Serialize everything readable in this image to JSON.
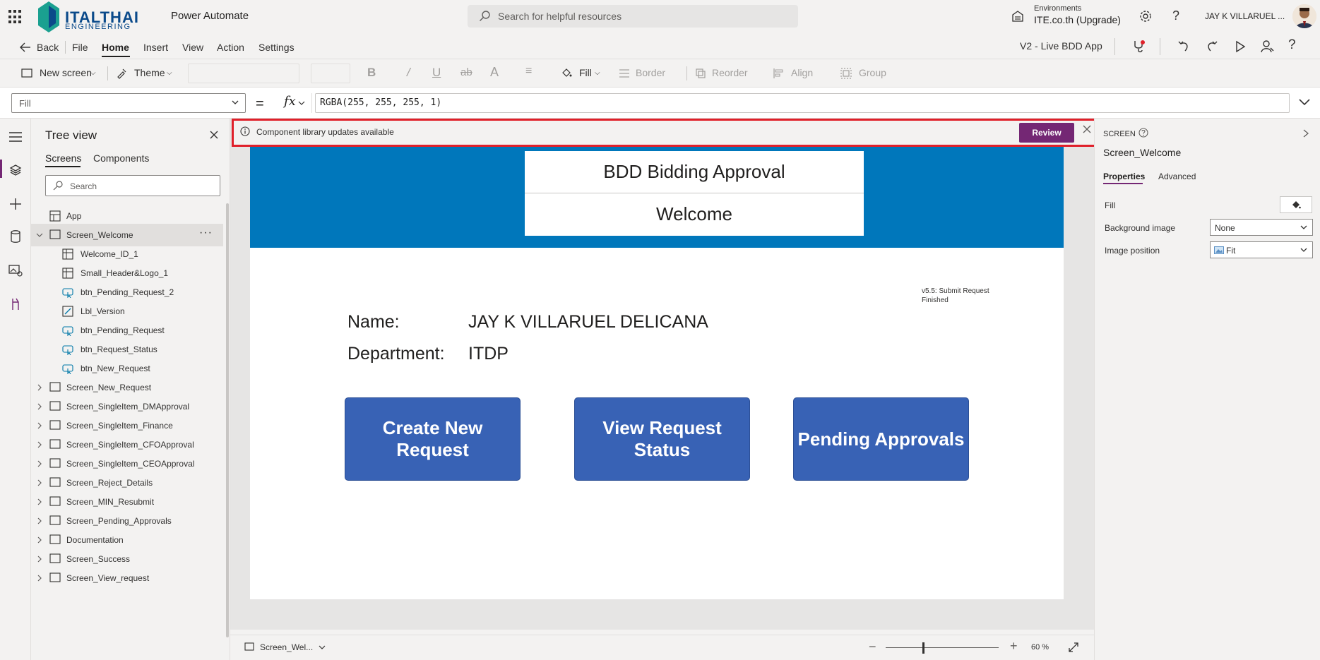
{
  "topbar": {
    "logo_primary": "ITALTHAI",
    "logo_secondary": "ENGINEERING",
    "app_name": "Power Automate",
    "search_placeholder": "Search for helpful resources",
    "environment_label": "Environments",
    "environment_name": "ITE.co.th (Upgrade)",
    "help_glyph": "?",
    "user_name": "JAY K VILLARUEL ..."
  },
  "menubar": {
    "back_label": "Back",
    "items": [
      "File",
      "Home",
      "Insert",
      "View",
      "Action",
      "Settings"
    ],
    "active": "Home",
    "app_version_name": "V2 - Live BDD App"
  },
  "ribbon": {
    "new_screen": "New screen",
    "theme": "Theme",
    "fill": "Fill",
    "border": "Border",
    "reorder": "Reorder",
    "align": "Align",
    "group": "Group"
  },
  "formula": {
    "property": "Fill",
    "equals": "=",
    "fx": "fx",
    "value": "RGBA(255, 255, 255, 1)"
  },
  "treeview": {
    "title": "Tree view",
    "tabs": [
      "Screens",
      "Components"
    ],
    "search_placeholder": "Search",
    "more_glyph": "···",
    "items": [
      {
        "label": "App",
        "level": 0,
        "kind": "app"
      },
      {
        "label": "Screen_Welcome",
        "level": 0,
        "kind": "screen",
        "expanded": true,
        "selected": true
      },
      {
        "label": "Welcome_ID_1",
        "level": 1,
        "kind": "component"
      },
      {
        "label": "Small_Header&Logo_1",
        "level": 1,
        "kind": "component"
      },
      {
        "label": "btn_Pending_Request_2",
        "level": 1,
        "kind": "button"
      },
      {
        "label": "Lbl_Version",
        "level": 1,
        "kind": "label"
      },
      {
        "label": "btn_Pending_Request",
        "level": 1,
        "kind": "button"
      },
      {
        "label": "btn_Request_Status",
        "level": 1,
        "kind": "button"
      },
      {
        "label": "btn_New_Request",
        "level": 1,
        "kind": "button"
      },
      {
        "label": "Screen_New_Request",
        "level": 0,
        "kind": "screen"
      },
      {
        "label": "Screen_SingleItem_DMApproval",
        "level": 0,
        "kind": "screen"
      },
      {
        "label": "Screen_SingleItem_Finance",
        "level": 0,
        "kind": "screen"
      },
      {
        "label": "Screen_SingleItem_CFOApproval",
        "level": 0,
        "kind": "screen"
      },
      {
        "label": "Screen_SingleItem_CEOApproval",
        "level": 0,
        "kind": "screen"
      },
      {
        "label": "Screen_Reject_Details",
        "level": 0,
        "kind": "screen"
      },
      {
        "label": "Screen_MIN_Resubmit",
        "level": 0,
        "kind": "screen"
      },
      {
        "label": "Screen_Pending_Approvals",
        "level": 0,
        "kind": "screen"
      },
      {
        "label": "Documentation",
        "level": 0,
        "kind": "screen"
      },
      {
        "label": "Screen_Success",
        "level": 0,
        "kind": "screen"
      },
      {
        "label": "Screen_View_request",
        "level": 0,
        "kind": "screen"
      }
    ]
  },
  "banner": {
    "message": "Component library updates available",
    "review_label": "Review"
  },
  "app_screen": {
    "header_title": "BDD Bidding Approval",
    "header_subtitle": "Welcome",
    "version_line1": "v5.5: Submit Request",
    "version_line2": "Finished",
    "name_label": "Name:",
    "name_value": "JAY K VILLARUEL DELICANA",
    "department_label": "Department:",
    "department_value": "ITDP",
    "buttons": [
      "Create New Request",
      "View Request Status",
      "Pending Approvals"
    ],
    "header_color": "#0077bb",
    "button_color": "#3862b5"
  },
  "canvas_footer": {
    "screen_selector": "Screen_Wel...",
    "zoom_minus": "−",
    "zoom_plus": "+",
    "zoom_value": "60  %",
    "zoom_percent": 60
  },
  "properties": {
    "type": "SCREEN",
    "name": "Screen_Welcome",
    "tabs": [
      "Properties",
      "Advanced"
    ],
    "fill_label": "Fill",
    "background_image_label": "Background image",
    "background_image_value": "None",
    "image_position_label": "Image position",
    "image_position_value": "Fit"
  },
  "colors": {
    "accent": "#742774",
    "highlight": "#e0202a"
  }
}
